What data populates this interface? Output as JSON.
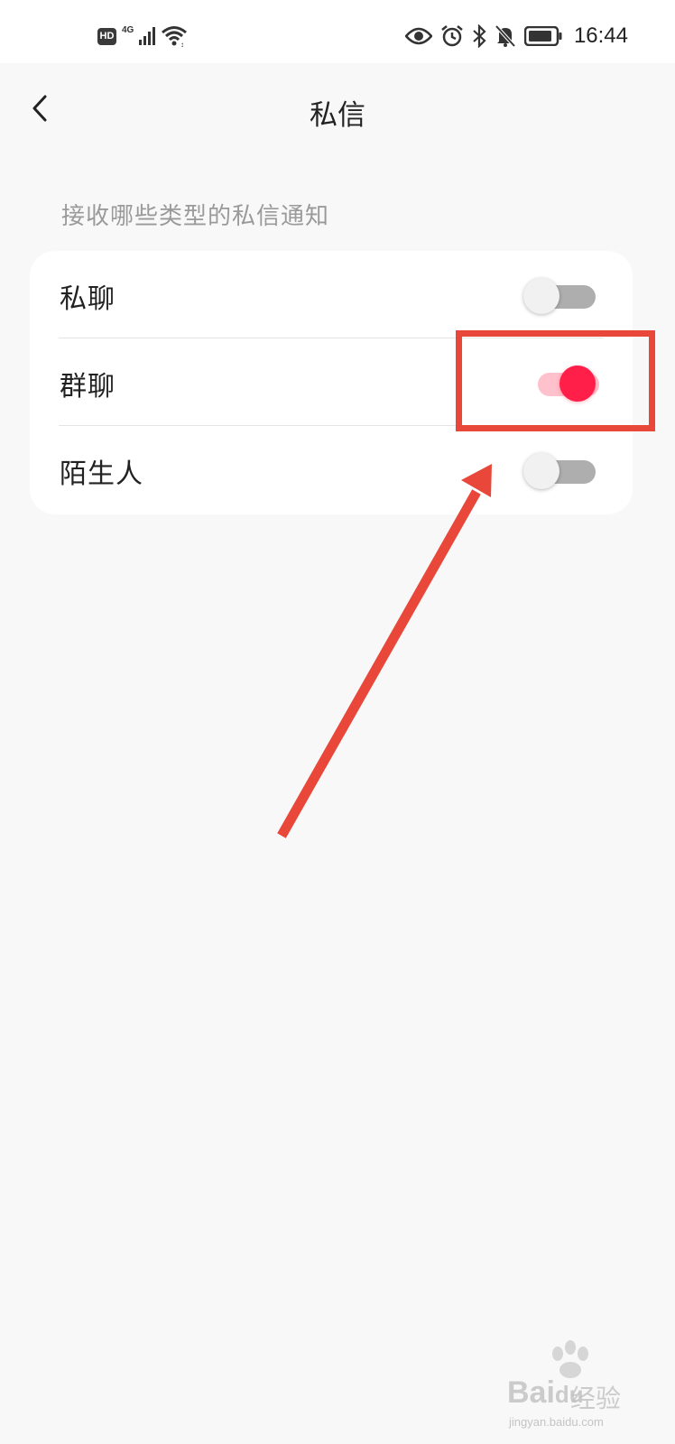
{
  "status_bar": {
    "hd_badge": "HD",
    "network_label": "4G",
    "time": "16:44",
    "icons": [
      "hd-icon",
      "signal-icon",
      "wifi-icon",
      "eye-icon",
      "alarm-icon",
      "bluetooth-icon",
      "mute-icon",
      "battery-icon"
    ]
  },
  "nav": {
    "back_icon": "chevron-left-icon",
    "title": "私信"
  },
  "section": {
    "label": "接收哪些类型的私信通知"
  },
  "settings": [
    {
      "label": "私聊",
      "enabled": false
    },
    {
      "label": "群聊",
      "enabled": true
    },
    {
      "label": "陌生人",
      "enabled": false
    }
  ],
  "annotation": {
    "color": "#e8473a",
    "target": "群聊"
  },
  "colors": {
    "accent": "#ff1f48",
    "accent_track": "#ffc1cb",
    "off_track": "#aeaeae",
    "background": "#f8f8f8"
  },
  "watermark": {
    "brand": "Bai",
    "brand_du": "du",
    "brand_suffix": "经验",
    "url": "jingyan.baidu.com"
  }
}
